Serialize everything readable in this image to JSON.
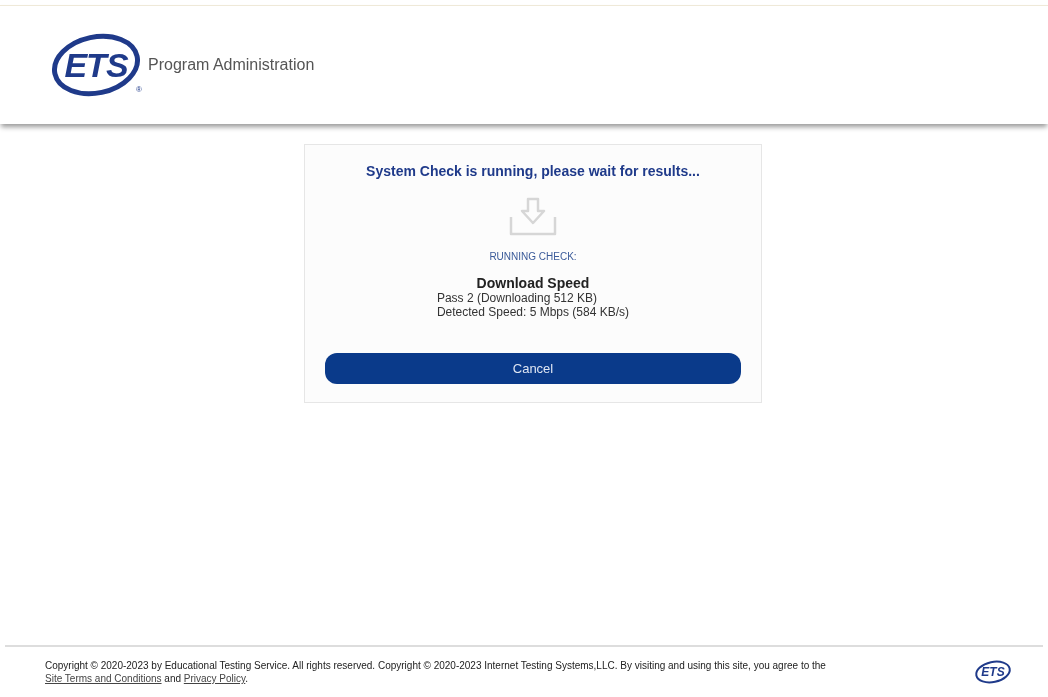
{
  "header": {
    "logo": {
      "text": "ETS",
      "mark": "®"
    },
    "title": "Program Administration"
  },
  "dialog": {
    "heading": "System Check is running, please wait for results...",
    "status_label": "RUNNING CHECK:",
    "check_name": "Download Speed",
    "details": [
      "Pass 2 (Downloading 512 KB)",
      "Detected Speed: 5 Mbps (584 KB/s)"
    ],
    "button": "Cancel"
  },
  "footer": {
    "text_start": "Copyright © 2020-2023 by Educational Testing Service. All rights reserved. Copyright © 2020-2023 Internet Testing Systems,LLC. By visiting and using this site, you agree to the",
    "links": [
      "Site Terms and Conditions",
      "Privacy Policy"
    ],
    "text_middle": "and",
    "text_end": ".",
    "logo": "ETS"
  }
}
